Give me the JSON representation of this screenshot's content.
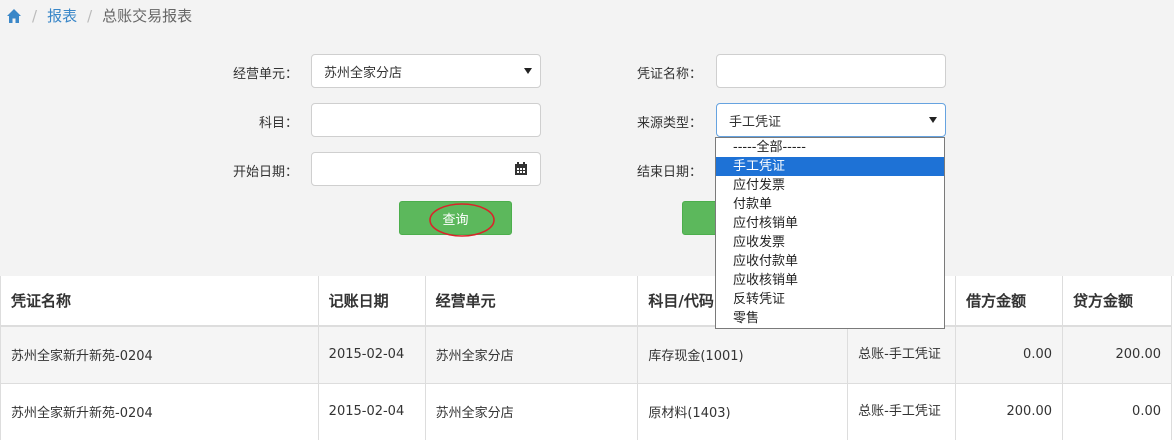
{
  "breadcrumb": {
    "home_icon": "home-icon",
    "items": [
      "报表",
      "总账交易报表"
    ]
  },
  "form": {
    "business_unit_label": "经营单元：",
    "business_unit_value": "苏州全家分店",
    "voucher_name_label": "凭证名称：",
    "voucher_name_value": "",
    "subject_label": "科目：",
    "subject_value": "",
    "source_type_label": "来源类型：",
    "source_type_value": "手工凭证",
    "start_date_label": "开始日期：",
    "start_date_value": "",
    "end_date_label": "结束日期：",
    "query_button": "查询"
  },
  "source_type_options": [
    "-----全部-----",
    "手工凭证",
    "应付发票",
    "付款单",
    "应付核销单",
    "应收发票",
    "应收付款单",
    "应收核销单",
    "反转凭证",
    "零售"
  ],
  "source_type_selected_index": 1,
  "table": {
    "headers": [
      "凭证名称",
      "记账日期",
      "经营单元",
      "科目/代码",
      "",
      "借方金额",
      "贷方金额"
    ],
    "rows": [
      [
        "苏州全家新升新苑-0204",
        "2015-02-04",
        "苏州全家分店",
        "库存现金(1001)",
        "总账-手工凭证",
        "0.00",
        "200.00"
      ],
      [
        "苏州全家新升新苑-0204",
        "2015-02-04",
        "苏州全家分店",
        "原材料(1403)",
        "总账-手工凭证",
        "200.00",
        "0.00"
      ]
    ]
  },
  "colors": {
    "accent_green": "#5cb85c",
    "link_blue": "#3a87c8",
    "selected_blue": "#1e72d6",
    "annotation_red": "#d9252a"
  }
}
